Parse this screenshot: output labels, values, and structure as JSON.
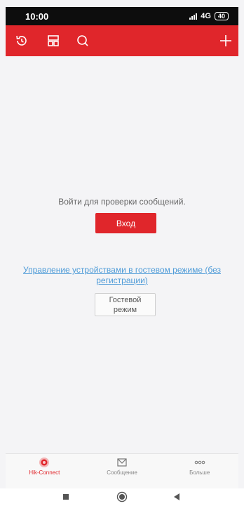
{
  "status_bar": {
    "time": "10:00",
    "network": "4G",
    "battery": "40"
  },
  "app_bar": {
    "icons": [
      "history-icon",
      "layout-icon",
      "search-icon",
      "add-icon"
    ]
  },
  "main": {
    "prompt": "Войти для проверки сообщений.",
    "login_label": "Вход",
    "guest_link": "Управление устройствами в гостевом режиме (без регистрации)",
    "guest_button_label": "Гостевой\nрежим"
  },
  "tabs": [
    {
      "label": "Hik-Connect",
      "icon": "hik-connect-icon",
      "active": true
    },
    {
      "label": "Сообщение",
      "icon": "message-icon",
      "active": false
    },
    {
      "label": "Больше",
      "icon": "more-icon",
      "active": false
    }
  ],
  "colors": {
    "brand": "#e0262b",
    "link": "#4f9cd8",
    "status_bar": "#0d0d0d"
  }
}
